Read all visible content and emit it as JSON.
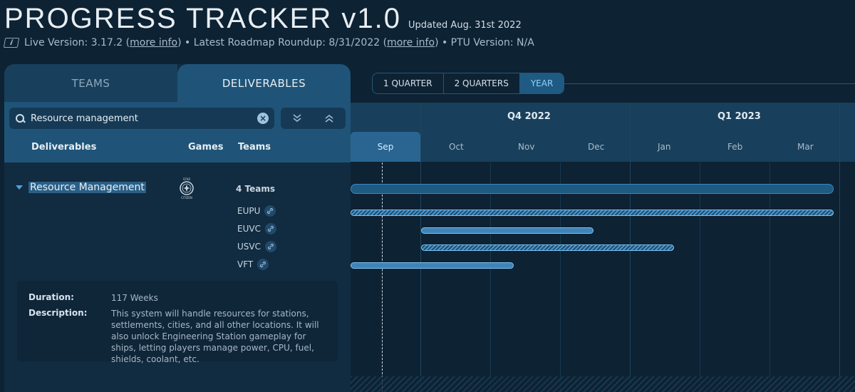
{
  "header": {
    "title": "PROGRESS TRACKER v1.0",
    "updated": "Updated Aug. 31st 2022",
    "live_version_text": "Live Version: 3.17.2 (",
    "more_info_1": "more info",
    "roadmap_text": ") • Latest Roadmap Roundup: 8/31/2022 (",
    "more_info_2": "more info",
    "ptu_text": ") • PTU Version: N/A",
    "info_icon": "info-icon"
  },
  "panel": {
    "tabs": [
      {
        "label": "TEAMS",
        "active": false
      },
      {
        "label": "DELIVERABLES",
        "active": true
      }
    ],
    "search": {
      "value": "Resource management",
      "clear_symbol": "×"
    },
    "collapse_symbols": {
      "collapse": "⌄⌄",
      "expand": "⌃⌃"
    },
    "columns": {
      "deliverables": "Deliverables",
      "games": "Games",
      "teams": "Teams"
    },
    "deliverable": {
      "name": "Resource Management",
      "game": "Star Citizen",
      "teams_count": "4 Teams",
      "teams": [
        "EUPU",
        "EUVC",
        "USVC",
        "VFT"
      ],
      "duration_label": "Duration:",
      "duration": "117 Weeks",
      "description_label": "Description:",
      "description": "This system will handle resources for stations, settlements, cities, and all other locations. It will also unlock Engineering Station gameplay for ships, letting players manage power, CPU, fuel, shields, coolant, etc."
    }
  },
  "timeline": {
    "ranges": [
      {
        "label": "1 QUARTER",
        "active": false
      },
      {
        "label": "2 QUARTERS",
        "active": false
      },
      {
        "label": "YEAR",
        "active": true
      }
    ],
    "quarters": [
      "Q4 2022",
      "Q1 2023"
    ],
    "months": [
      "Sep",
      "Oct",
      "Nov",
      "Dec",
      "Jan",
      "Feb",
      "Mar"
    ],
    "current_month": "Sep",
    "colors": {
      "accent": "#4ea3d9",
      "active_range": "#8fd0ff",
      "bar": "#3f84b8"
    }
  }
}
